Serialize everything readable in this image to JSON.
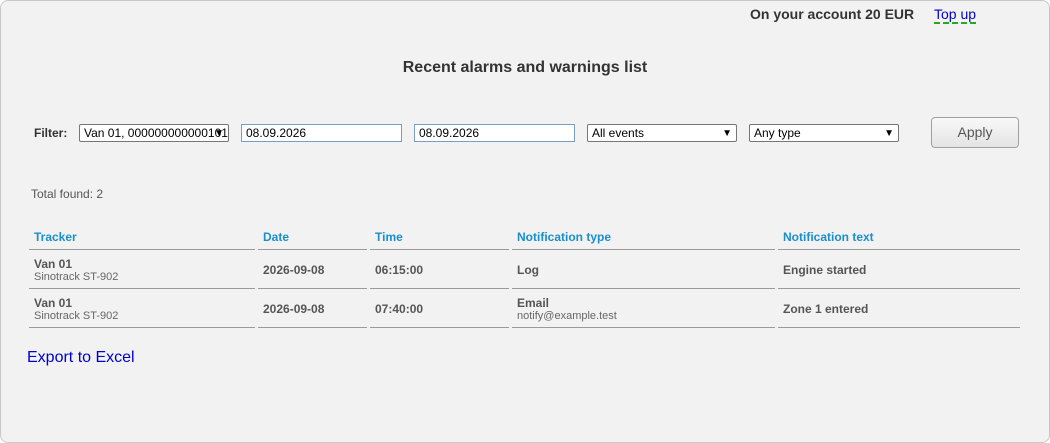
{
  "account": {
    "balance_text": "On your account 20 EUR",
    "topup_label": "Top up"
  },
  "page_title": "Recent alarms and warnings list",
  "filter": {
    "label": "Filter:",
    "tracker_value": "Van 01, 000000000000101",
    "date_from": "08.09.2026",
    "date_to": "08.09.2026",
    "events_value": "All events",
    "type_value": "Any type",
    "apply_label": "Apply"
  },
  "total_found": "Total found: 2",
  "table": {
    "headers": [
      "Tracker",
      "Date",
      "Time",
      "Notification type",
      "Notification text"
    ],
    "rows": [
      {
        "tracker": "Van 01",
        "device": "Sinotrack ST-902",
        "date": "2026-09-08",
        "time": "06:15:00",
        "type": "Log",
        "type_detail": "",
        "text": "Engine started"
      },
      {
        "tracker": "Van 01",
        "device": "Sinotrack ST-902",
        "date": "2026-09-08",
        "time": "07:40:00",
        "type": "Email",
        "type_detail": "notify@example.test",
        "text": "Zone 1 entered"
      }
    ]
  },
  "export_label": "Export to Excel"
}
